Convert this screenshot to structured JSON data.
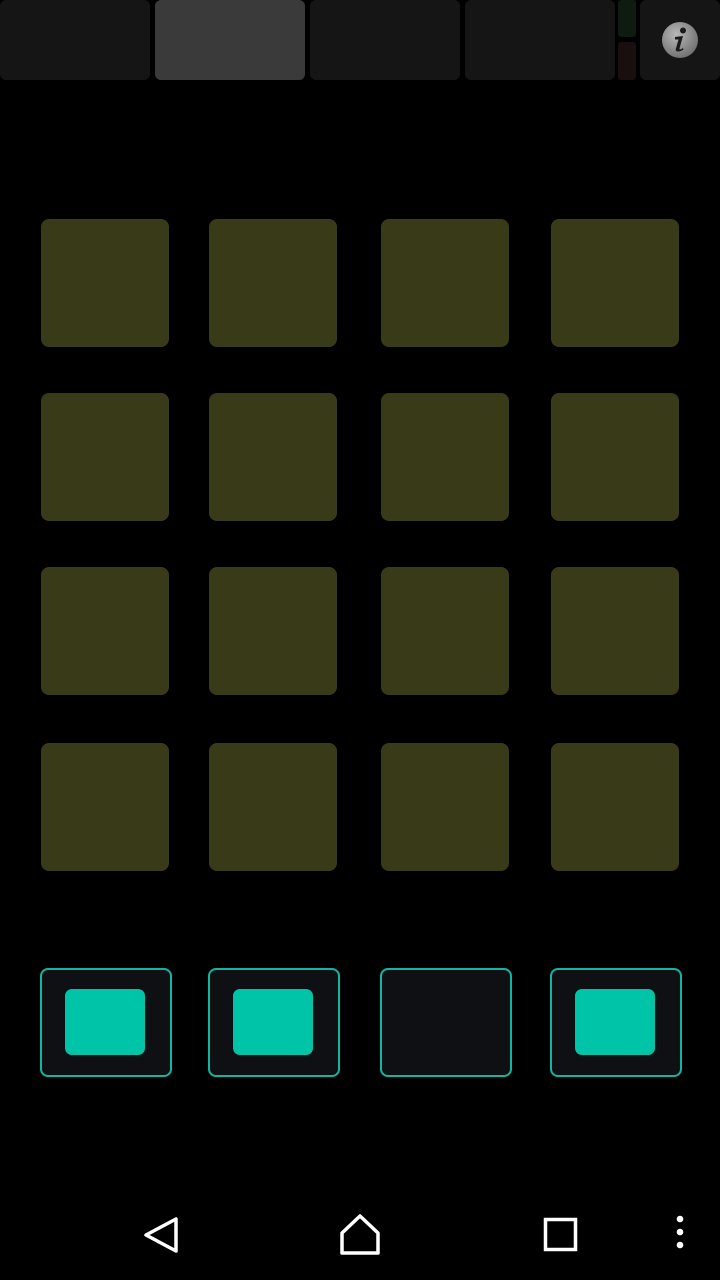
{
  "top_bar": {
    "tabs": [
      {
        "id": "tab-1",
        "active": false
      },
      {
        "id": "tab-2",
        "active": true
      },
      {
        "id": "tab-3",
        "active": false
      },
      {
        "id": "tab-4",
        "active": false
      }
    ],
    "info_icon": "info-icon"
  },
  "pad_grid": {
    "rows": 4,
    "columns": 4,
    "pad_color": "#393a17"
  },
  "steps": [
    {
      "on": true
    },
    {
      "on": true
    },
    {
      "on": false
    },
    {
      "on": true
    }
  ],
  "colors": {
    "step_on": "#00c4a8",
    "step_border": "#12b6a0",
    "active_tab": "#3a3a3a",
    "inactive_tab": "#151515"
  },
  "nav_bar": {
    "icons": [
      "back-icon",
      "home-icon",
      "recents-icon",
      "overflow-menu-icon"
    ]
  }
}
